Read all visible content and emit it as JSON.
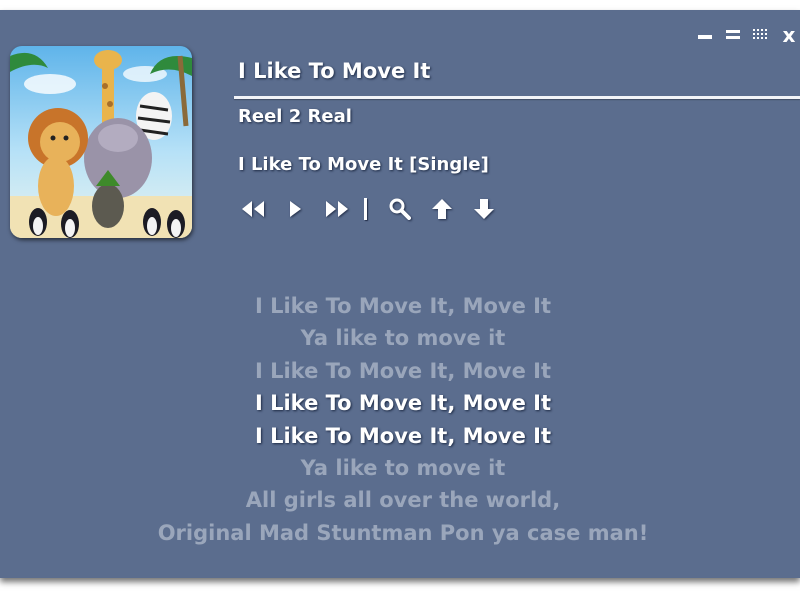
{
  "window": {
    "controls": [
      {
        "name": "minimize",
        "icon": "minimize-icon"
      },
      {
        "name": "restore",
        "icon": "restore-icon"
      },
      {
        "name": "options",
        "icon": "grid-dots-icon"
      },
      {
        "name": "close",
        "label": "x",
        "icon": "close-icon"
      }
    ]
  },
  "album_art": {
    "icon": "album-cover-image"
  },
  "track": {
    "title": "I Like To Move It",
    "artist": "Reel 2 Real",
    "album": "I Like To Move It [Single]"
  },
  "player_controls": [
    {
      "name": "previous",
      "icon": "rewind-icon"
    },
    {
      "name": "play",
      "icon": "play-icon"
    },
    {
      "name": "next",
      "icon": "fast-forward-icon"
    },
    {
      "name": "search",
      "icon": "magnifier-icon"
    },
    {
      "name": "scroll-up",
      "icon": "arrow-up-icon"
    },
    {
      "name": "scroll-down",
      "icon": "arrow-down-icon"
    }
  ],
  "lyrics": {
    "lines": [
      {
        "text": "I Like To Move It, Move It",
        "state": "dim"
      },
      {
        "text": "Ya like to move it",
        "state": "dim"
      },
      {
        "text": "I Like To Move It, Move It",
        "state": "dim"
      },
      {
        "text": "I Like To Move It, Move It",
        "state": "active"
      },
      {
        "text": "I Like To Move It, Move It",
        "state": "active"
      },
      {
        "text": "Ya like to move it",
        "state": "dim"
      },
      {
        "text": "All girls all over the world,",
        "state": "dim"
      },
      {
        "text": "Original Mad Stuntman Pon ya case man!",
        "state": "dim"
      }
    ]
  },
  "colors": {
    "background": "#5b6d8e",
    "text_active": "#ffffff",
    "text_dim": "#9aa6bb"
  }
}
